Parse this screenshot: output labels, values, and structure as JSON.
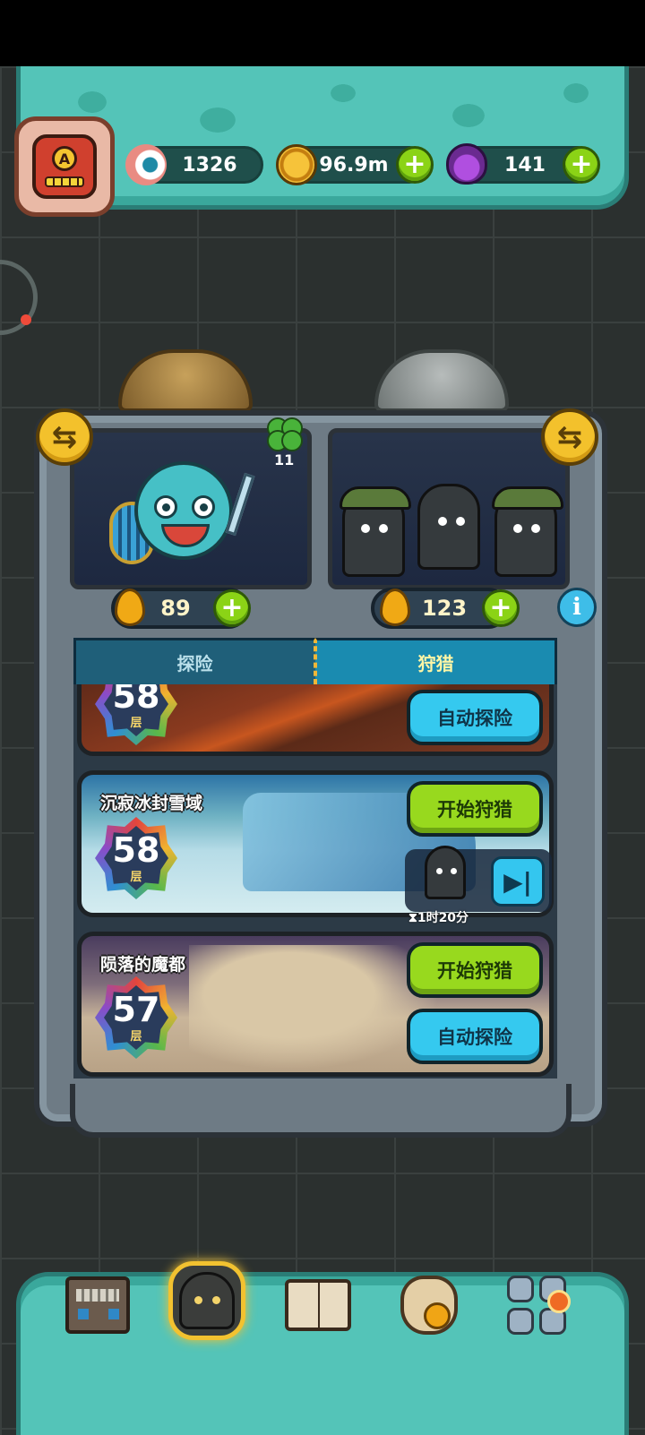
{
  "resources": {
    "eyeballs": "1326",
    "gold": "96.9m",
    "potions": "141",
    "plus": "+"
  },
  "player": {
    "rank": "A"
  },
  "party": {
    "clover_count": "11",
    "left_energy": "89",
    "right_energy": "123",
    "swap_glyph": "⇆",
    "info_glyph": "i"
  },
  "tabs": {
    "explore": "探险",
    "hunt": "狩猎"
  },
  "stages": [
    {
      "floor": "58",
      "floor_unit": "层",
      "auto_label": "自动探险"
    },
    {
      "name": "沉寂冰封雪域",
      "floor": "58",
      "floor_unit": "层",
      "hunt_label": "开始狩猎",
      "timer": "1时20分",
      "skip_glyph": "▶|"
    },
    {
      "name": "陨落的魔都",
      "floor": "57",
      "floor_unit": "层",
      "hunt_label": "开始狩猎",
      "auto_label": "自动探险"
    }
  ],
  "colors": {
    "slime_panel": "#54c4b8",
    "green_button": "#98d91e",
    "blue_button": "#35c9ef",
    "gold_accent": "#f3c12c"
  },
  "icons": {
    "eyeball": "eyeball-icon",
    "coin": "coin-icon",
    "potion": "potion-icon",
    "clover": "clover-icon",
    "energy": "energy-drop-icon",
    "info": "info-icon",
    "swap": "swap-icon",
    "nav": [
      "shop-icon",
      "monster-icon",
      "book-icon",
      "bag-icon",
      "menu-grid-icon"
    ]
  }
}
